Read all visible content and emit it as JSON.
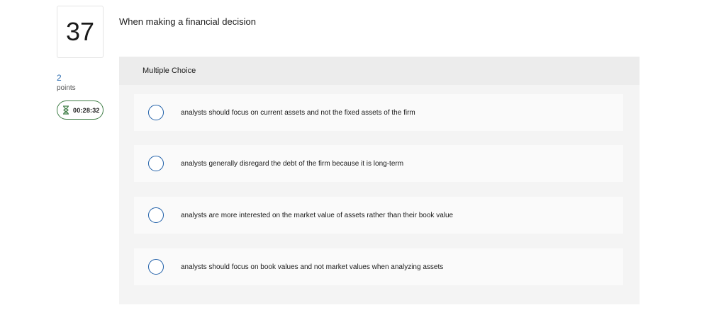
{
  "question": {
    "number": "37",
    "points_value": "2",
    "points_label": "points",
    "timer": "00:28:32",
    "prompt": "When making a financial decision"
  },
  "multiple_choice": {
    "header": "Multiple Choice",
    "options": [
      {
        "label": "analysts should focus on current assets and not the fixed assets of the firm"
      },
      {
        "label": "analysts generally disregard the debt of the firm because it is long-term"
      },
      {
        "label": "analysts are more interested on the market value of assets rather than their book value"
      },
      {
        "label": "analysts should focus on book values and not market values when analyzing assets"
      }
    ]
  },
  "colors": {
    "radio_border": "#1f5fa8",
    "timer_border": "#3f7d46",
    "points_value": "#2b6cb0"
  },
  "icons": {
    "timer": "hourglass-icon"
  }
}
